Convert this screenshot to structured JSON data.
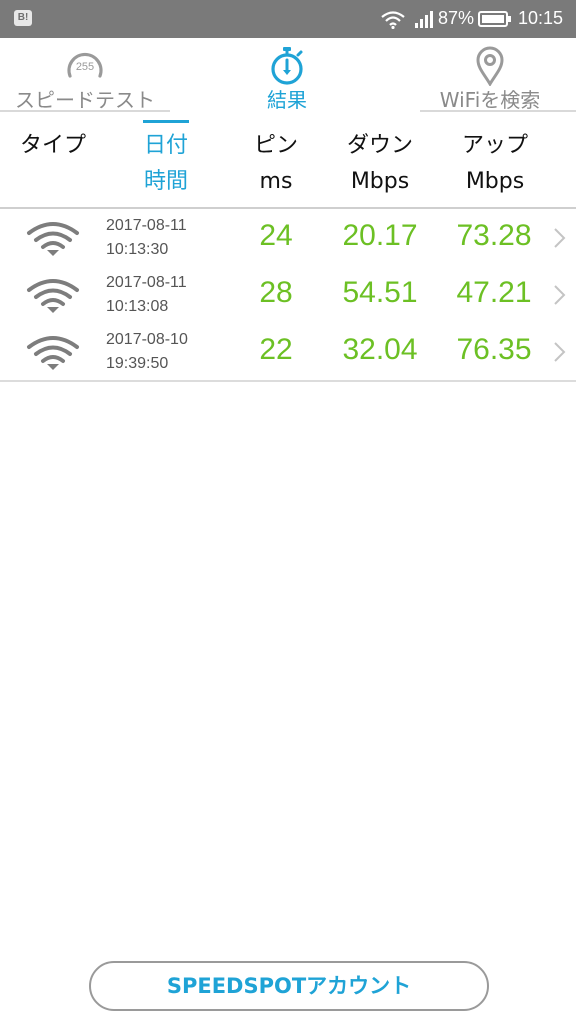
{
  "status_bar": {
    "app_icon_label": "B!",
    "battery_percent": "87%",
    "time": "10:15"
  },
  "tabs": [
    {
      "label": "スピードテスト",
      "icon": "speedometer-icon",
      "gauge_text": "255",
      "active": false
    },
    {
      "label": "結果",
      "icon": "stopwatch-icon",
      "active": true
    },
    {
      "label": "WiFiを検索",
      "icon": "location-pin-icon",
      "active": false
    }
  ],
  "columns": {
    "type": "タイプ",
    "datetime_line1": "日付",
    "datetime_line2": "時間",
    "ping_line1": "ピン",
    "ping_line2": "ms",
    "down_line1": "ダウン",
    "down_line2": "Mbps",
    "up_line1": "アップ",
    "up_line2": "Mbps"
  },
  "results": [
    {
      "type_icon": "wifi-icon",
      "date": "2017-08-11",
      "time": "10:13:30",
      "ping": "24",
      "download": "20.17",
      "upload": "73.28"
    },
    {
      "type_icon": "wifi-icon",
      "date": "2017-08-11",
      "time": "10:13:08",
      "ping": "28",
      "download": "54.51",
      "upload": "47.21"
    },
    {
      "type_icon": "wifi-icon",
      "date": "2017-08-10",
      "time": "19:39:50",
      "ping": "22",
      "download": "32.04",
      "upload": "76.35"
    }
  ],
  "account_button_label": "SPEEDSPOTアカウント",
  "colors": {
    "accent": "#1fa3d6",
    "value_green": "#6cc024",
    "status_bar": "#7a7a7a"
  }
}
